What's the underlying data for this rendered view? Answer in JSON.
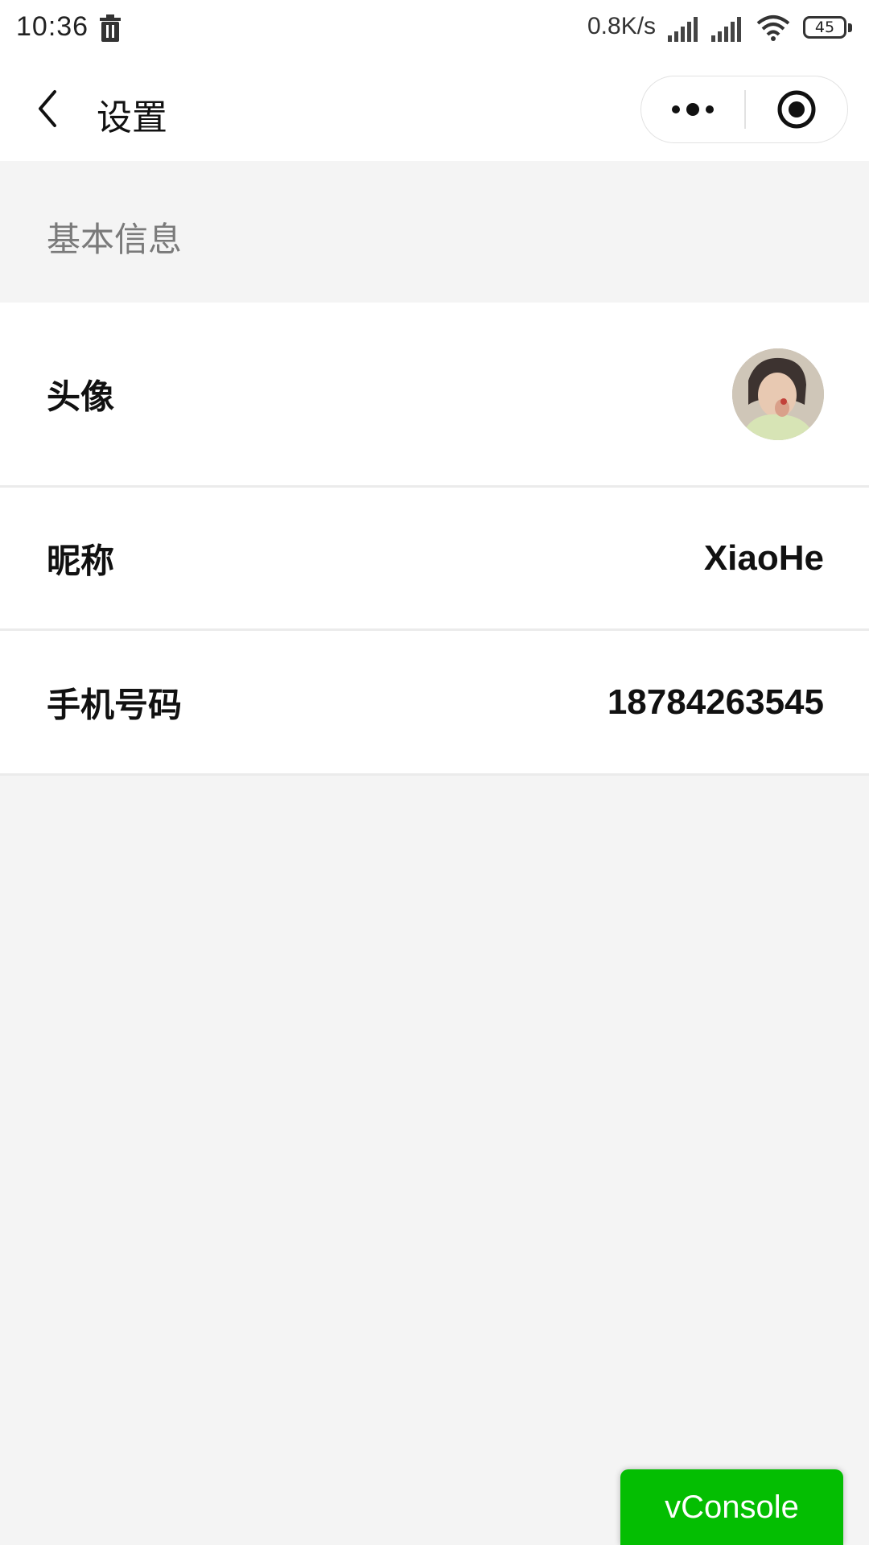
{
  "status_bar": {
    "time": "10:36",
    "net_speed": "0.8K/s",
    "battery": "45",
    "icons": [
      "trash-icon",
      "signal-icon",
      "signal-icon",
      "wifi-icon",
      "battery-icon"
    ]
  },
  "nav": {
    "title": "设置",
    "back_icon": "chevron-left-icon",
    "more_icon": "more-dots-icon",
    "close_icon": "target-close-icon"
  },
  "section": {
    "title": "基本信息"
  },
  "rows": [
    {
      "label": "头像",
      "value": ""
    },
    {
      "label": "昵称",
      "value": "XiaoHe"
    },
    {
      "label": "手机号码",
      "value": "18784263545"
    }
  ],
  "vconsole": {
    "label": "vConsole",
    "color": "#04be02"
  },
  "colors": {
    "background": "#f4f4f4",
    "row_background": "#ffffff",
    "section_text": "#7a7a7a"
  }
}
